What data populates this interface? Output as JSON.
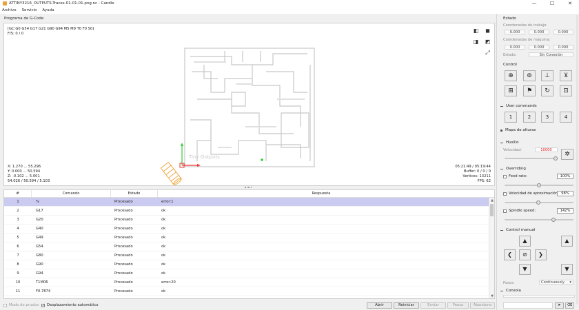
{
  "window": {
    "title": "ATTINY3216_OUTPUTS-Traces-01-01-01.png.nc - Candle",
    "minimize": "—",
    "maximize": "☐",
    "close": "✕"
  },
  "menu": [
    "Archivo",
    "Servicio",
    "Ayuda"
  ],
  "gcode_panel": {
    "title": "Programa de G-Code",
    "status_line1": "[GC:G0 G54 G17 G21 G90 G94 M5 M9 T0 F0 S0]",
    "status_line2": "F/S: 0 / 0",
    "bounds_x": "X: 1.270 ... 55.296",
    "bounds_y": "Y: 0.000 ... 50.594",
    "bounds_z": "Z: -0.102 ... 5.001",
    "bounds_size": "54.026 / 50.594 / 5.103",
    "time": "05:21:49 / 05:19:44",
    "buffer": "Buffer: 0 / 0 / 0",
    "vertices": "Vertices: 13211",
    "fps": "FPS: 62"
  },
  "table": {
    "headers": [
      "#",
      "Comando",
      "Estado",
      "Respuesta"
    ],
    "rows": [
      {
        "n": "1",
        "cmd": "%",
        "state": "Procesado",
        "resp": "error:1"
      },
      {
        "n": "2",
        "cmd": "G17",
        "state": "Procesado",
        "resp": "ok"
      },
      {
        "n": "3",
        "cmd": "G20",
        "state": "Procesado",
        "resp": "ok"
      },
      {
        "n": "4",
        "cmd": "G40",
        "state": "Procesado",
        "resp": "ok"
      },
      {
        "n": "5",
        "cmd": "G49",
        "state": "Procesado",
        "resp": "ok"
      },
      {
        "n": "6",
        "cmd": "G54",
        "state": "Procesado",
        "resp": "ok"
      },
      {
        "n": "7",
        "cmd": "G80",
        "state": "Procesado",
        "resp": "ok"
      },
      {
        "n": "8",
        "cmd": "G90",
        "state": "Procesado",
        "resp": "ok"
      },
      {
        "n": "9",
        "cmd": "G94",
        "state": "Procesado",
        "resp": "ok"
      },
      {
        "n": "10",
        "cmd": "T1M06",
        "state": "Procesado",
        "resp": "error:20"
      },
      {
        "n": "11",
        "cmd": "F0.7874",
        "state": "Procesado",
        "resp": "ok"
      }
    ]
  },
  "bottom": {
    "test_mode": "Modo de prueba",
    "autoscroll": "Desplazamiento automático",
    "open": "Abrir",
    "reset": "Reiniciar",
    "send": "Enviar",
    "pause": "Pausa",
    "abort": "Abandono"
  },
  "state_panel": {
    "title": "Estado",
    "work_label": "Coordenadas de trabajo:",
    "work": [
      "0.000",
      "0.000",
      "0.000"
    ],
    "machine_label": "Coordenadas de máquina:",
    "machine": [
      "0.000",
      "0.000",
      "0.000"
    ],
    "status_label": "Estado:",
    "status_value": "Sin Conexión"
  },
  "control": {
    "title": "Control"
  },
  "user_commands": {
    "title": "User commands",
    "buttons": [
      "1",
      "2",
      "3",
      "4"
    ]
  },
  "height_map": {
    "title": "Mapa de alturas"
  },
  "spindle": {
    "title": "Husillo",
    "speed_label": "Velocidad:",
    "speed_value": "10000",
    "speed_color": "#e02020",
    "slider_fraction": 0.97
  },
  "overriding": {
    "title": "Overriding",
    "feed_label": "Feed rate:",
    "feed_value": "100%",
    "feed_fraction": 0.5,
    "approach_label": "Velocidad de aproximación:",
    "approach_value": "98%",
    "approach_fraction": 0.49,
    "spindle_label": "Spindle speed:",
    "spindle_value": "142%",
    "spindle_fraction": 0.71
  },
  "manual": {
    "title": "Control manual",
    "step_label": "Pasos:",
    "step_value": "Continuously"
  },
  "console": {
    "title": "Consola"
  }
}
